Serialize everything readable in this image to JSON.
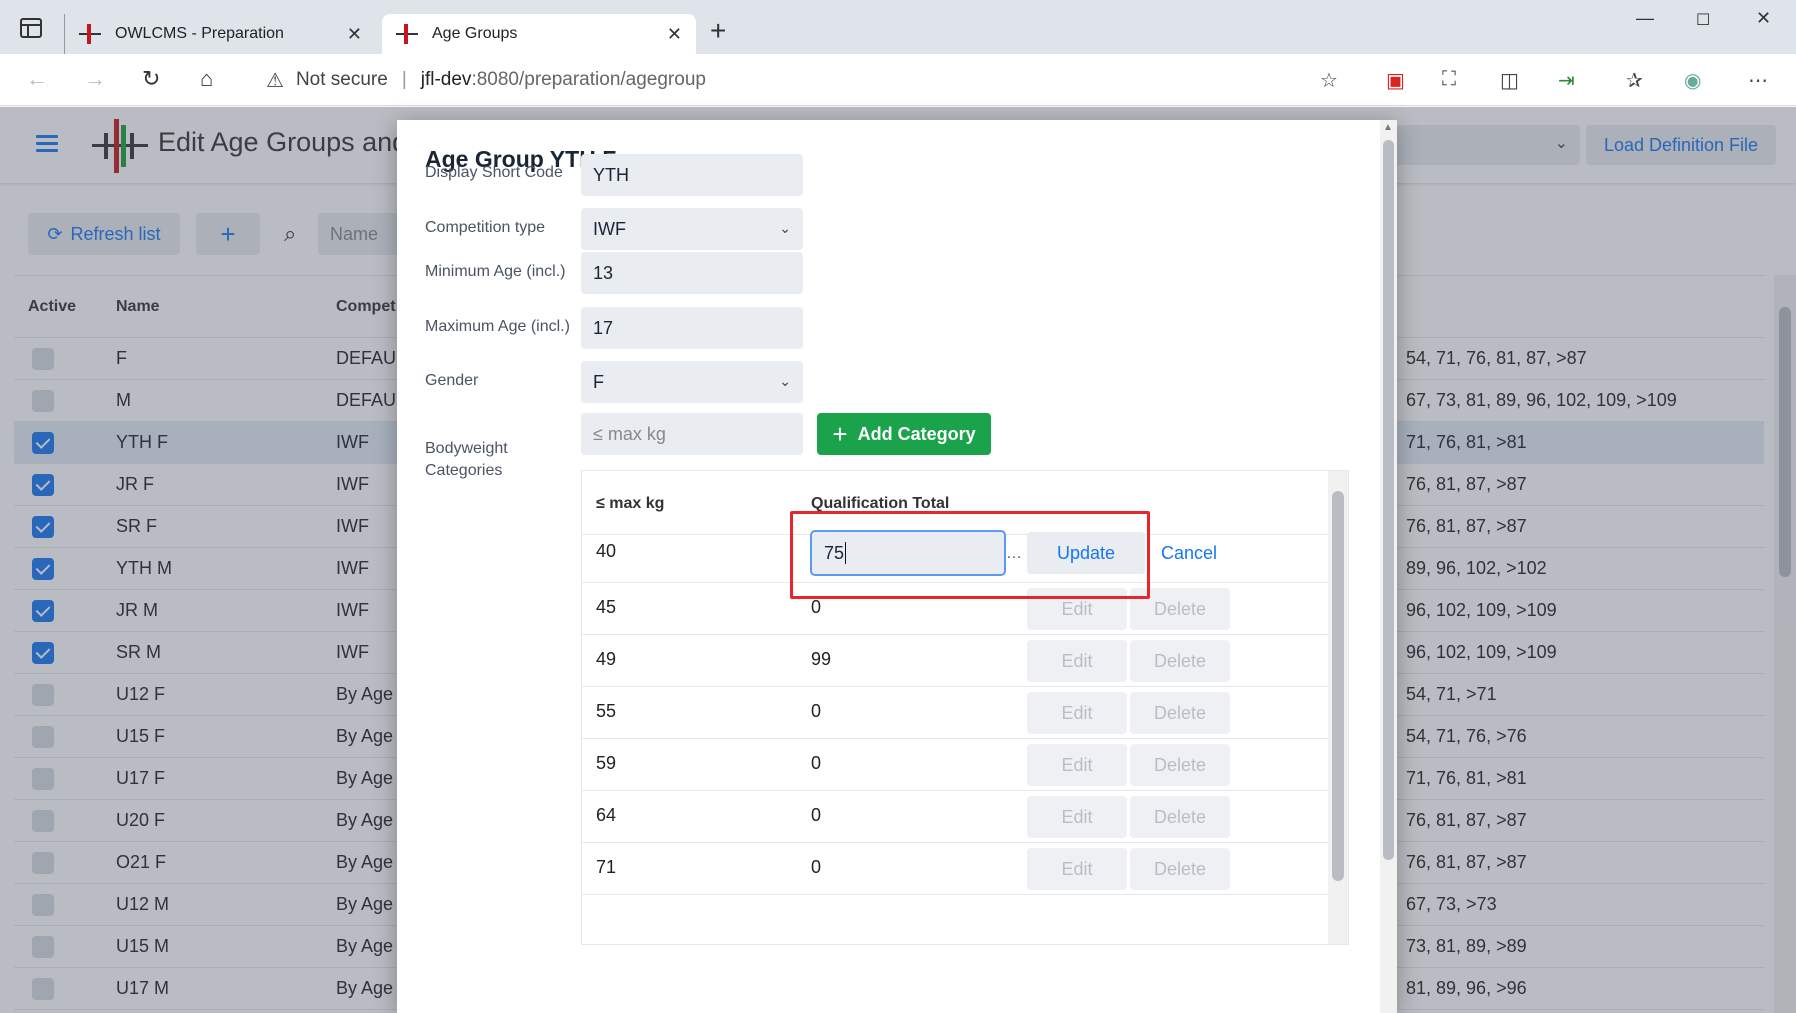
{
  "browser": {
    "tabs": [
      {
        "title": "OWLCMS - Preparation",
        "active": false
      },
      {
        "title": "Age Groups",
        "active": true
      }
    ],
    "new_tab": "+",
    "security": "Not secure",
    "url_host": "jfl-dev",
    "url_path": ":8080/preparation/agegroup"
  },
  "app": {
    "title": "Edit Age Groups and",
    "load_button": "Load Definition File",
    "refresh_button": "Refresh list",
    "add_button": "+",
    "name_placeholder": "Name",
    "columns": [
      "Active",
      "Name",
      "Compet"
    ],
    "rows": [
      {
        "active": false,
        "name": "F",
        "comp": "DEFAUL",
        "cats": "54, 71, 76, 81, 87, >87"
      },
      {
        "active": false,
        "name": "M",
        "comp": "DEFAUL",
        "cats": "67, 73, 81, 89, 96, 102, 109, >109"
      },
      {
        "active": true,
        "name": "YTH F",
        "comp": "IWF",
        "cats": "71, 76, 81, >81",
        "selected": true
      },
      {
        "active": true,
        "name": "JR F",
        "comp": "IWF",
        "cats": "76, 81, 87, >87"
      },
      {
        "active": true,
        "name": "SR F",
        "comp": "IWF",
        "cats": "76, 81, 87, >87"
      },
      {
        "active": true,
        "name": "YTH M",
        "comp": "IWF",
        "cats": "89, 96, 102, >102"
      },
      {
        "active": true,
        "name": "JR M",
        "comp": "IWF",
        "cats": "96, 102, 109, >109"
      },
      {
        "active": true,
        "name": "SR M",
        "comp": "IWF",
        "cats": "96, 102, 109, >109"
      },
      {
        "active": false,
        "name": "U12 F",
        "comp": "By Age",
        "cats": "54, 71, >71"
      },
      {
        "active": false,
        "name": "U15 F",
        "comp": "By Age",
        "cats": "54, 71, 76, >76"
      },
      {
        "active": false,
        "name": "U17 F",
        "comp": "By Age",
        "cats": "71, 76, 81, >81"
      },
      {
        "active": false,
        "name": "U20 F",
        "comp": "By Age",
        "cats": "76, 81, 87, >87"
      },
      {
        "active": false,
        "name": "O21 F",
        "comp": "By Age",
        "cats": "76, 81, 87, >87"
      },
      {
        "active": false,
        "name": "U12 M",
        "comp": "By Age",
        "cats": "67, 73, >73"
      },
      {
        "active": false,
        "name": "U15 M",
        "comp": "By Age",
        "cats": "73, 81, 89, >89"
      },
      {
        "active": false,
        "name": "U17 M",
        "comp": "By Age",
        "cats": "81, 89, 96, >96"
      }
    ]
  },
  "modal": {
    "title": "Age Group YTH F",
    "short_code_label": "Display Short Code",
    "short_code": "YTH",
    "competition_type_label": "Competition type",
    "competition_type": "IWF",
    "min_age_label": "Minimum Age (incl.)",
    "min_age": "13",
    "max_age_label": "Maximum Age (incl.)",
    "max_age": "17",
    "gender_label": "Gender",
    "gender": "F",
    "bw_label": "Bodyweight Categories",
    "max_kg_placeholder": "≤ max kg",
    "add_category": "Add Category",
    "cat_columns": [
      "≤ max kg",
      "Qualification Total"
    ],
    "editing": {
      "kg": "40",
      "value": "75",
      "update": "Update",
      "cancel": "Cancel"
    },
    "categories": [
      {
        "kg": "45",
        "total": "0"
      },
      {
        "kg": "49",
        "total": "99"
      },
      {
        "kg": "55",
        "total": "0"
      },
      {
        "kg": "59",
        "total": "0"
      },
      {
        "kg": "64",
        "total": "0"
      },
      {
        "kg": "71",
        "total": "0"
      }
    ],
    "edit_label": "Edit",
    "delete_label": "Delete"
  }
}
